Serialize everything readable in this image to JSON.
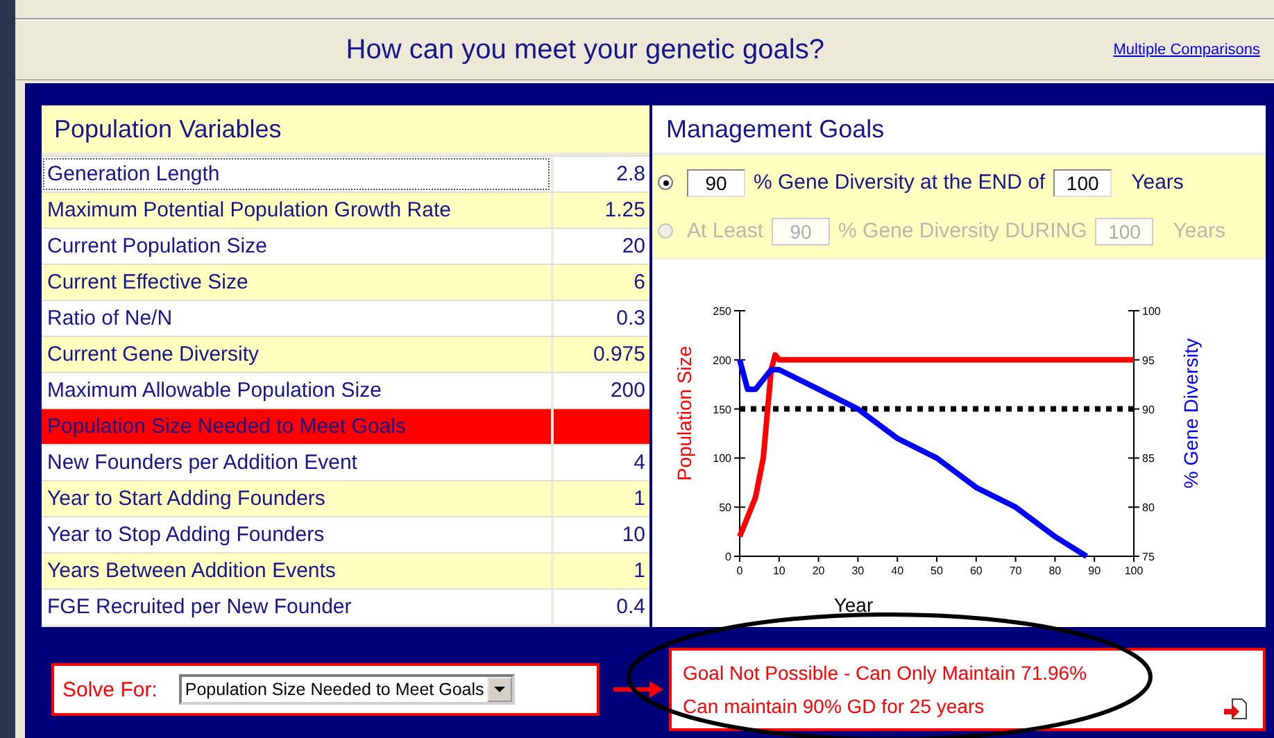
{
  "header": {
    "title": "How can you meet your genetic goals?",
    "link": "Multiple Comparisons"
  },
  "population_variables": {
    "title": "Population Variables",
    "rows": [
      {
        "label": "Generation Length",
        "value": "2.8",
        "focused": true,
        "highlighted": false
      },
      {
        "label": "Maximum Potential Population Growth Rate",
        "value": "1.25",
        "focused": false,
        "highlighted": false
      },
      {
        "label": "Current Population Size",
        "value": "20",
        "focused": false,
        "highlighted": false
      },
      {
        "label": "Current Effective Size",
        "value": "6",
        "focused": false,
        "highlighted": false
      },
      {
        "label": "Ratio of Ne/N",
        "value": "0.3",
        "focused": false,
        "highlighted": false
      },
      {
        "label": "Current Gene Diversity",
        "value": "0.975",
        "focused": false,
        "highlighted": false
      },
      {
        "label": "Maximum Allowable Population Size",
        "value": "200",
        "focused": false,
        "highlighted": false
      },
      {
        "label": "Population Size Needed to Meet Goals",
        "focused": false,
        "highlighted": true
      },
      {
        "label": "New Founders per Addition Event",
        "value": "4",
        "focused": false,
        "highlighted": false
      },
      {
        "label": "Year to Start Adding Founders",
        "value": "1",
        "focused": false,
        "highlighted": false
      },
      {
        "label": "Year to Stop Adding Founders",
        "value": "10",
        "focused": false,
        "highlighted": false
      },
      {
        "label": "Years Between  Addition Events",
        "value": "1",
        "focused": false,
        "highlighted": false
      },
      {
        "label": "FGE Recruited per New Founder",
        "value": "0.4",
        "focused": false,
        "highlighted": false
      }
    ]
  },
  "management_goals": {
    "title": "Management Goals",
    "options": [
      {
        "selected": true,
        "disabled": false,
        "parts": [
          {
            "kind": "input",
            "value": "90"
          },
          {
            "kind": "text",
            "text": "% Gene Diversity at the END of"
          },
          {
            "kind": "input",
            "value": "100"
          },
          {
            "kind": "text",
            "text": "Years"
          }
        ]
      },
      {
        "selected": false,
        "disabled": true,
        "parts": [
          {
            "kind": "text",
            "text": "At Least"
          },
          {
            "kind": "input",
            "value": "90"
          },
          {
            "kind": "text",
            "text": "% Gene Diversity DURING"
          },
          {
            "kind": "input",
            "value": "100"
          },
          {
            "kind": "text",
            "text": "Years"
          }
        ]
      }
    ],
    "chart_data": {
      "type": "line",
      "xlabel": "Year",
      "x": [
        0,
        2,
        4,
        6,
        8,
        9,
        10,
        20,
        30,
        40,
        50,
        60,
        70,
        80,
        88,
        100
      ],
      "series": [
        {
          "name": "Population Size",
          "color": "#ff0000",
          "values": [
            20,
            40,
            60,
            100,
            190,
            205,
            200,
            200,
            200,
            200,
            200,
            200,
            200,
            200,
            200,
            200
          ]
        },
        {
          "name": "% Gene Diversity",
          "color": "#0000ff",
          "axis": "y2",
          "values": [
            95,
            92,
            92,
            93,
            94,
            94,
            94,
            92,
            90,
            87,
            85,
            82,
            80,
            77,
            75,
            null
          ]
        }
      ],
      "ref_lines": [
        {
          "axis": "y2",
          "value": 90,
          "color": "#000000"
        }
      ],
      "xlim": [
        0,
        100
      ],
      "ylim": [
        0,
        250
      ],
      "y2lim": [
        75,
        100
      ],
      "xticks": [
        0,
        10,
        20,
        30,
        40,
        50,
        60,
        70,
        80,
        90,
        100
      ],
      "yticks": [
        0,
        50,
        100,
        150,
        200,
        250
      ],
      "y2ticks": [
        75,
        80,
        85,
        90,
        95,
        100
      ]
    }
  },
  "solve_for": {
    "label": "Solve For:",
    "value": "Population Size Needed to Meet Goals"
  },
  "result": {
    "lines": [
      "Goal Not Possible - Can Only Maintain 71.96%",
      "Can maintain 90% GD for 25 years"
    ]
  }
}
